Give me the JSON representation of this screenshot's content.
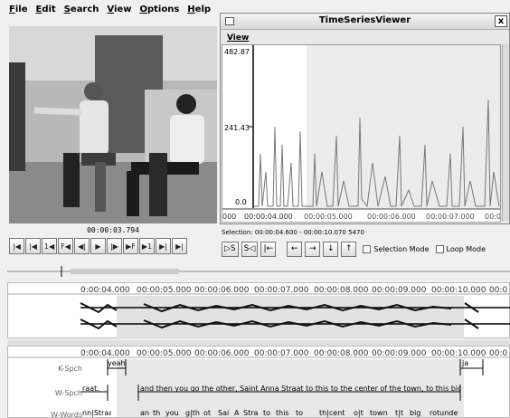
{
  "menu": [
    "File",
    "Edit",
    "Search",
    "View",
    "Options",
    "Help"
  ],
  "player": {
    "time": "00:00:03.794",
    "controls": [
      "|◀",
      "|◀",
      "1◀",
      "F◀",
      "◀|",
      "▶",
      "|▶",
      "▶F",
      "▶1",
      "▶|",
      "▶|"
    ]
  },
  "ts_window": {
    "title": "TimeSeriesViewer",
    "close": "x",
    "view_menu": "View",
    "y_ticks": [
      "482.87",
      "241.43",
      "0.0"
    ],
    "x_ticks": [
      "000",
      "00:00:04.000",
      "00:00:05.000",
      "00:00:06.000",
      "00:00:07.000",
      "00:00"
    ]
  },
  "selection": {
    "label": "Selection: 00:00:04.600 - 00:00:10.070 5470",
    "buttons": [
      "▷S",
      "S◁",
      "|←",
      "←",
      "→",
      "↓",
      "↑"
    ],
    "selection_mode": "Selection Mode",
    "loop_mode": "Loop Mode"
  },
  "ruler": {
    "ticks": [
      "0:00:04.000",
      "00:00:05.000",
      "00:00:06.000",
      "00:00:07.000",
      "00:00:08.000",
      "00:00:09.000",
      "00:00:10.000",
      "00:0"
    ]
  },
  "tiers": [
    {
      "name": "K-Spch",
      "annotations": [
        {
          "text": "yeah"
        },
        {
          "text": "ja"
        }
      ]
    },
    {
      "name": "W-Spch",
      "annotations": [
        {
          "text": "raat."
        },
        {
          "text": "and then you go the other, Saint Anna Straat to this to the center of the town, to this big rotun"
        }
      ]
    },
    {
      "name": "W-Words",
      "annotations": [
        {
          "text": "nn|Straa"
        },
        {
          "text": "an"
        },
        {
          "text": "th"
        },
        {
          "text": "you"
        },
        {
          "text": "g|th"
        },
        {
          "text": "ot"
        },
        {
          "text": "Sai"
        },
        {
          "text": "A"
        },
        {
          "text": "Stra"
        },
        {
          "text": "to"
        },
        {
          "text": "this"
        },
        {
          "text": "to"
        },
        {
          "text": "th|cent"
        },
        {
          "text": "o|t"
        },
        {
          "text": "town"
        },
        {
          "text": "t|t"
        },
        {
          "text": "big"
        },
        {
          "text": "rotunde"
        }
      ]
    }
  ]
}
